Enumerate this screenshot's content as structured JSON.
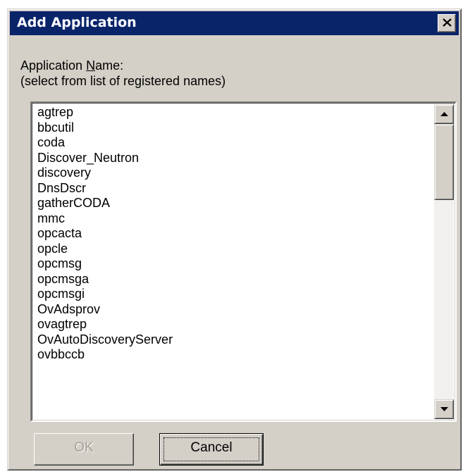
{
  "window": {
    "title": "Add Application"
  },
  "labels": {
    "name_prefix": "Application ",
    "name_accel": "N",
    "name_suffix": "ame:",
    "hint": "(select from list of registered names)"
  },
  "list": {
    "items": [
      "agtrep",
      "bbcutil",
      "coda",
      "Discover_Neutron",
      "discovery",
      "DnsDscr",
      "gatherCODA",
      "mmc",
      "opcacta",
      "opcle",
      "opcmsg",
      "opcmsga",
      "opcmsgi",
      "OvAdsprov",
      "ovagtrep",
      "OvAutoDiscoveryServer",
      "ovbbccb"
    ]
  },
  "buttons": {
    "ok_label": "OK",
    "cancel_label": "Cancel"
  },
  "icons": {
    "close": "close-icon",
    "scroll_up": "scroll-up-arrow-icon",
    "scroll_down": "scroll-down-arrow-icon"
  },
  "colors": {
    "title_bar": "#0a246a",
    "face": "#d4d0c8",
    "disabled_text": "#a19e96"
  },
  "state": {
    "ok_enabled": false,
    "focused_button": "Cancel"
  }
}
